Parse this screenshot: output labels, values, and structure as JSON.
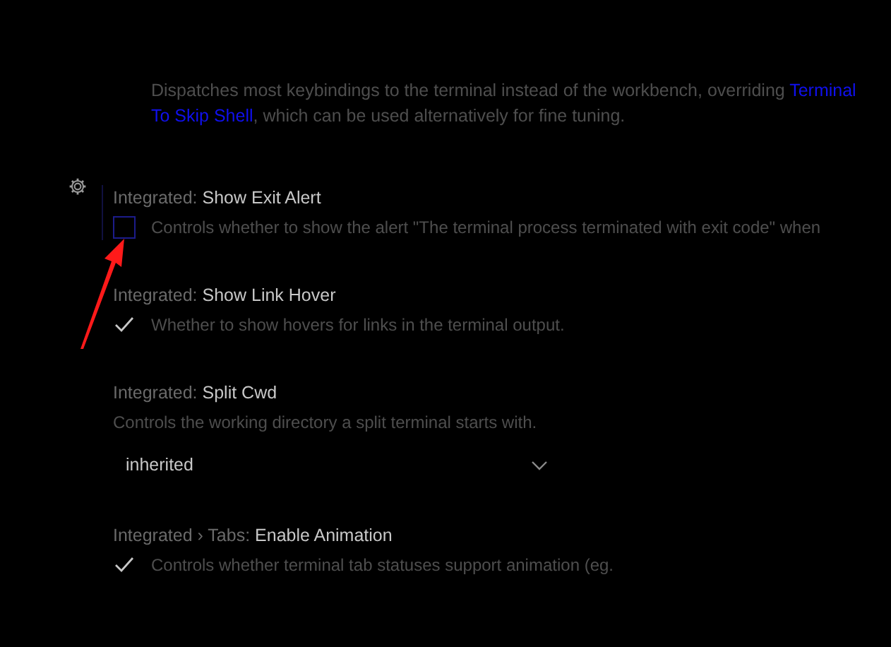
{
  "settings": [
    {
      "kind": "description",
      "lines": [
        [
          {
            "kind": "text",
            "text": "Dispatches most keybindings to the terminal instead of the workbench, overriding "
          },
          {
            "kind": "link",
            "text": "Terminal"
          }
        ],
        [
          {
            "kind": "link",
            "text": "To Skip Shell"
          },
          {
            "kind": "text",
            "text": ", which can be used alternatively for fine tuning."
          }
        ]
      ]
    },
    {
      "kind": "checkbox",
      "category": "Integrated: ",
      "name": "Show Exit Alert",
      "focused": true,
      "checked": false,
      "description": "Controls whether to show the alert \"The terminal process terminated with exit code\" when"
    },
    {
      "kind": "checkbox",
      "category": "Integrated: ",
      "name": "Show Link Hover",
      "focused": false,
      "checked": true,
      "description": "Whether to show hovers for links in the terminal output."
    },
    {
      "kind": "dropdown",
      "category": "Integrated: ",
      "name": "Split Cwd",
      "focused": false,
      "description": "Controls the working directory a split terminal starts with.",
      "value": "inherited"
    },
    {
      "kind": "checkbox",
      "category": "Integrated › Tabs: ",
      "name": "Enable Animation",
      "focused": false,
      "checked": true,
      "description": "Controls whether terminal tab statuses support animation (eg."
    }
  ]
}
